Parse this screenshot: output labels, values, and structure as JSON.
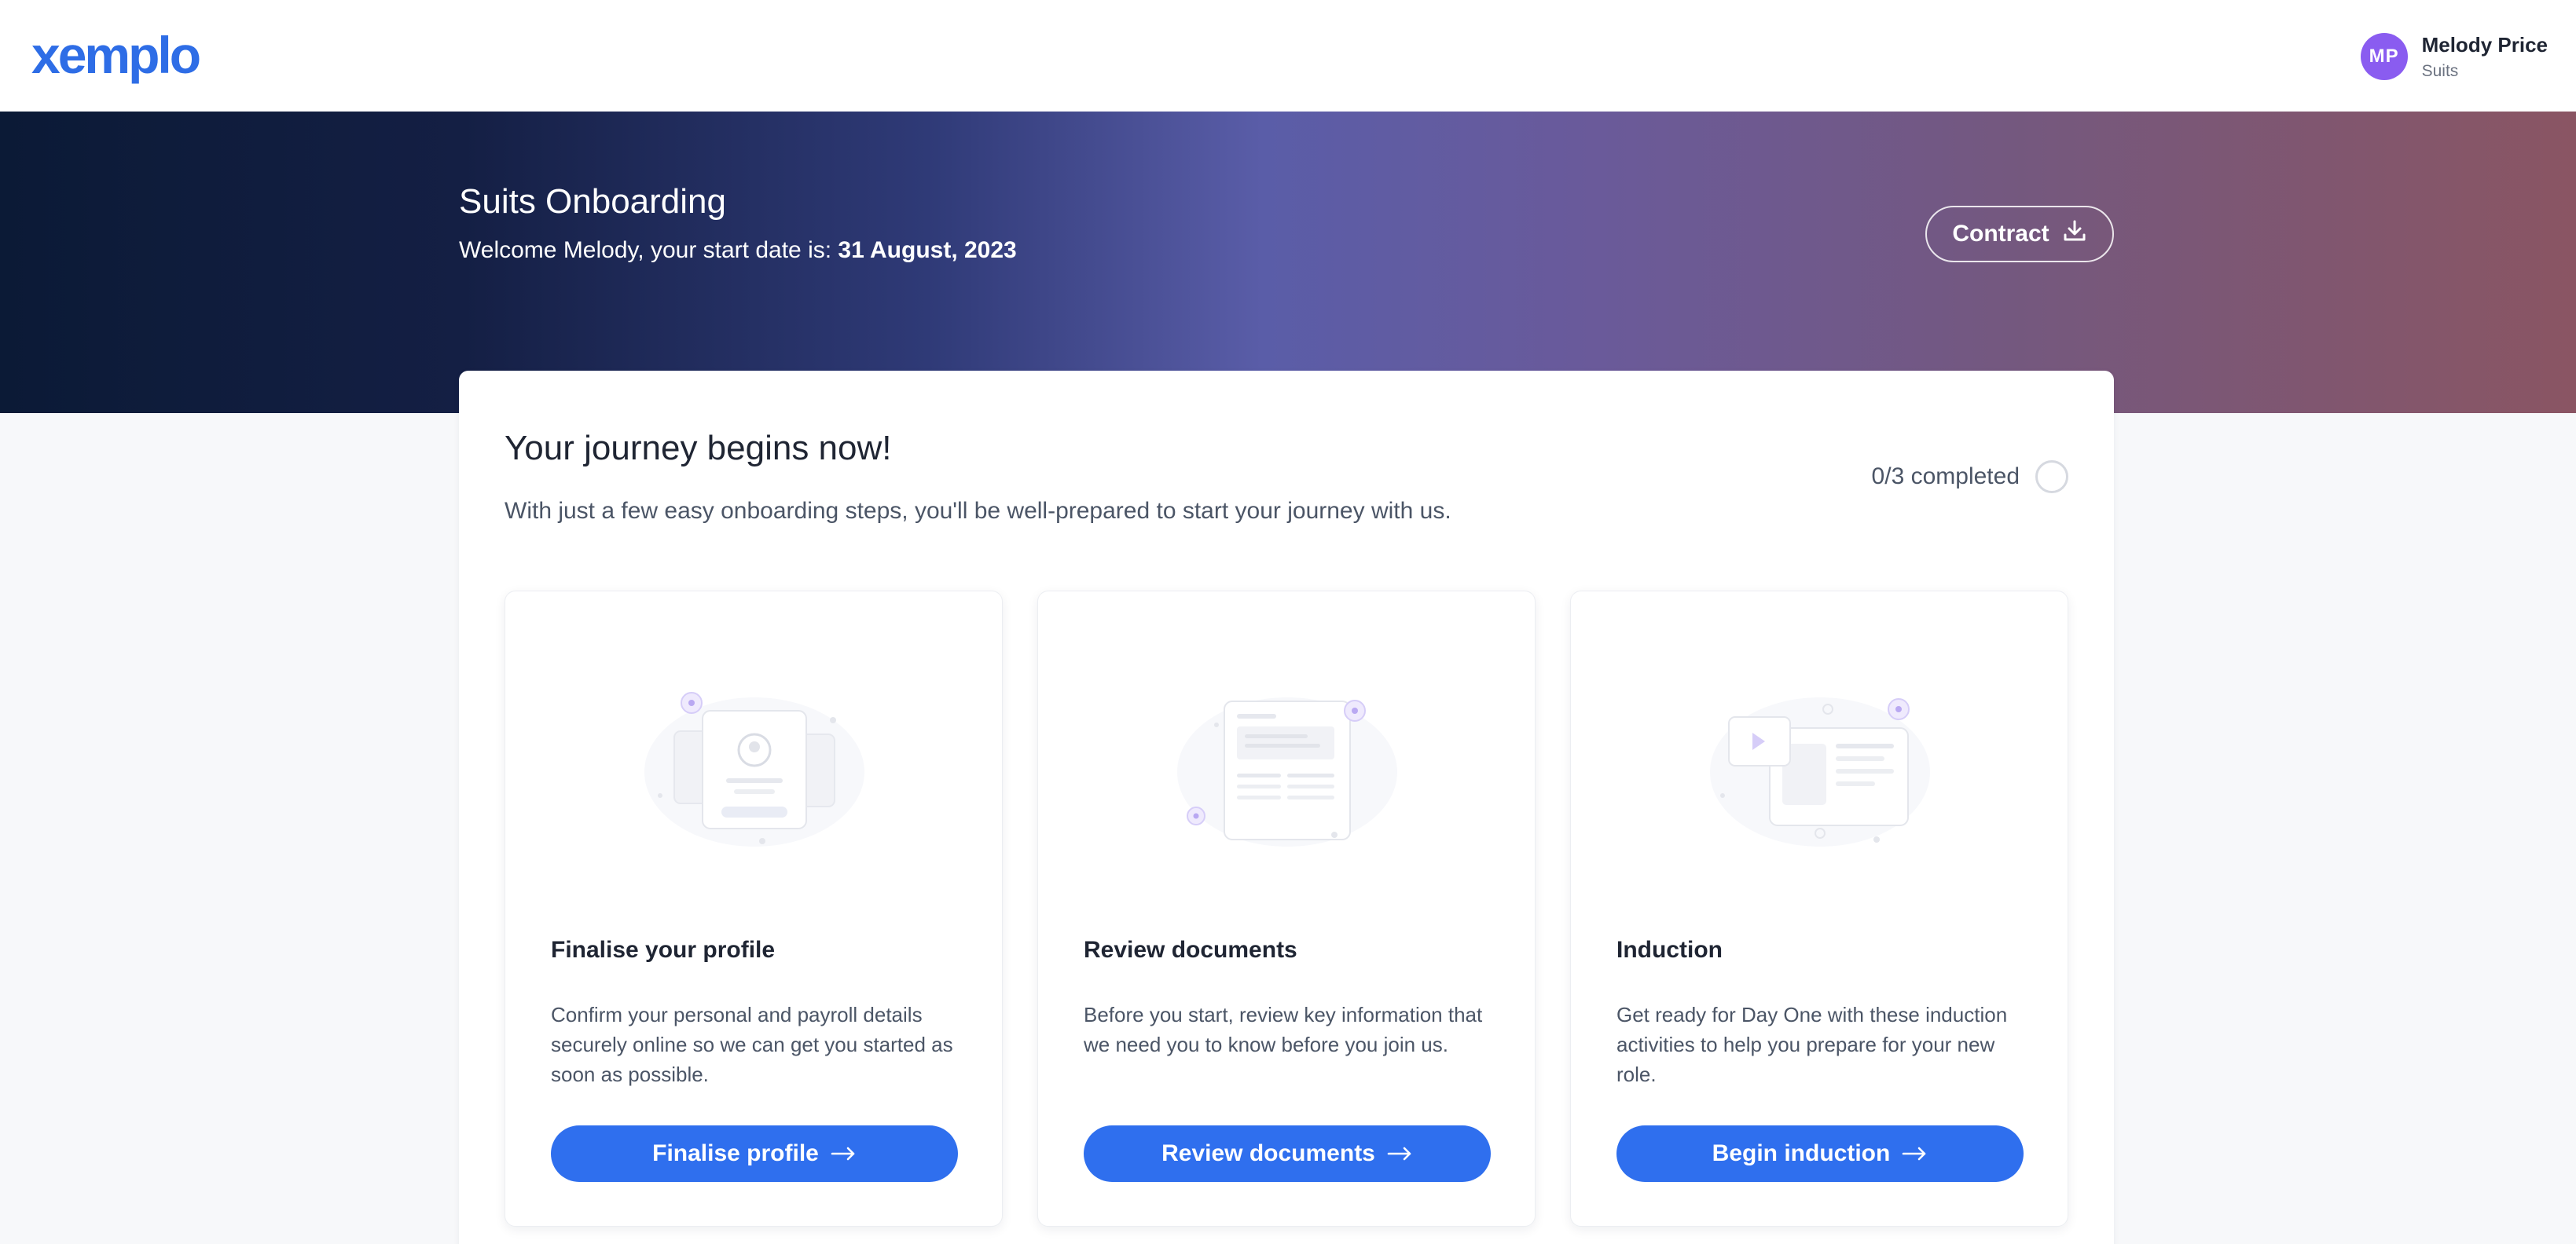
{
  "brand": {
    "logo_text": "xemplo",
    "accent": "#2f6fee"
  },
  "user": {
    "initials": "MP",
    "name": "Melody Price",
    "company": "Suits",
    "avatar_color": "#8a5cf0"
  },
  "hero": {
    "title": "Suits Onboarding",
    "welcome_prefix": "Welcome Melody, your start date is: ",
    "start_date": "31 August, 2023",
    "contract_label": "Contract",
    "contract_icon": "download-icon"
  },
  "journey": {
    "title": "Your journey begins now!",
    "subtitle": "With just a few easy onboarding steps, you'll be well-prepared to start your journey with us.",
    "progress_label": "0/3 completed",
    "progress_fraction": 0
  },
  "steps": [
    {
      "title": "Finalise your profile",
      "description": "Confirm your personal and payroll details securely online so we can get you started as soon as possible.",
      "button": "Finalise profile",
      "illustration": "profile-illustration"
    },
    {
      "title": "Review documents",
      "description": "Before you start, review key information that we need you to know before you join us.",
      "button": "Review documents",
      "illustration": "documents-illustration"
    },
    {
      "title": "Induction",
      "description": "Get ready for Day One with these induction activities to help you prepare for your new role.",
      "button": "Begin induction",
      "illustration": "induction-illustration"
    }
  ]
}
